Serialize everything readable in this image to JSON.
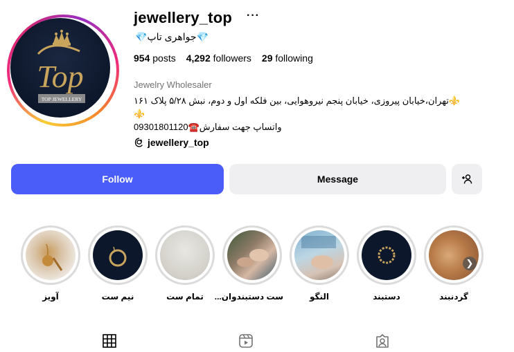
{
  "profile": {
    "username": "jewellery_top",
    "more_label": "···",
    "full_name": "💎جواهری تاپ💎",
    "posts_count": "954",
    "posts_label": " posts",
    "followers_count": "4,292",
    "followers_label": " followers",
    "following_count": "29",
    "following_label": " following",
    "category": "Jewelry Wholesaler",
    "bio_line1": "⚜️تهران،خیابان پیروزی، خیابان پنجم نیروهوایی، بین فلکه اول و دوم، نبش ۵/۲۸ پلاک ۱۶۱",
    "bio_line2": "⚜️",
    "bio_line3": "09301801120☎️واتساپ جهت سفارش",
    "threads_handle": "jewellery_top",
    "logo_text": "TOP JEWELLERY",
    "logo_monogram": "Top"
  },
  "actions": {
    "follow_label": "Follow",
    "message_label": "Message",
    "add_user_icon": "person-add-icon"
  },
  "highlights": [
    {
      "label": "آویز"
    },
    {
      "label": "نیم ست"
    },
    {
      "label": "تمام ست"
    },
    {
      "label": "ست دستبندوان..."
    },
    {
      "label": "النگو"
    },
    {
      "label": "دستبند"
    },
    {
      "label": "گردنبند"
    }
  ],
  "tabs": {
    "posts_icon": "grid-icon",
    "reels_icon": "reels-icon",
    "tagged_icon": "tagged-icon"
  },
  "colors": {
    "follow_button": "#4a5df9",
    "secondary_button": "#efeff2",
    "logo_gold": "#c9a45c",
    "logo_bg": "#0d172b"
  }
}
